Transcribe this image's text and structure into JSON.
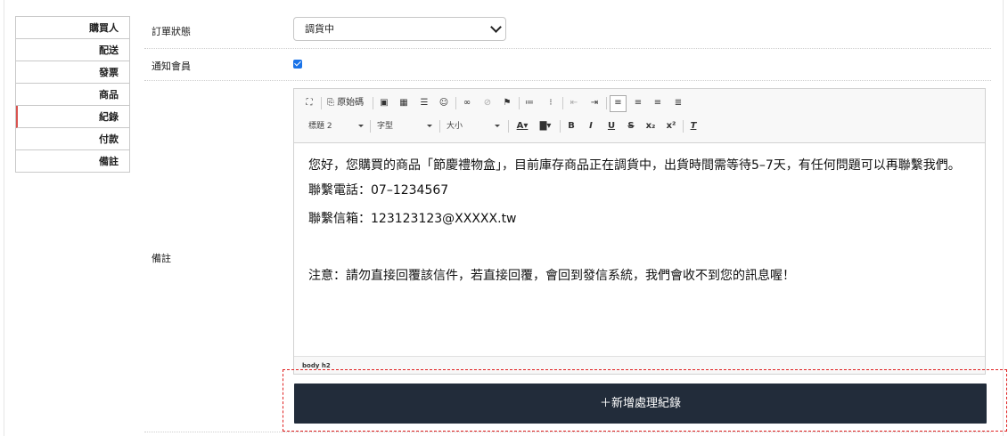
{
  "sidebar": {
    "items": [
      {
        "label": "購買人"
      },
      {
        "label": "配送"
      },
      {
        "label": "發票"
      },
      {
        "label": "商品"
      },
      {
        "label": "紀錄"
      },
      {
        "label": "付款"
      },
      {
        "label": "備註"
      }
    ]
  },
  "form": {
    "order_status_label": "訂單狀態",
    "order_status_value": "調貨中",
    "notify_label": "通知會員",
    "notify_checked": true,
    "note_label": "備註"
  },
  "editor": {
    "toolbar": {
      "source_label": "原始碼",
      "format_value": "標題 2",
      "font_value": "字型",
      "size_value": "大小"
    },
    "content": {
      "line1": "您好，您購買的商品「節慶禮物盒」，目前庫存商品正在調貨中，出貨時間需等待5–7天，有任何問題可以再聯繫我們。",
      "line2": "聯繫電話：07–1234567",
      "line3": "聯繫信箱：123123123@XXXXX.tw",
      "line4": "注意：請勿直接回覆該信件，若直接回覆，會回到發信系統，我們會收不到您的訊息喔！"
    },
    "status_path": "body  h2"
  },
  "actions": {
    "add_record_label": "＋新增處理紀錄"
  },
  "colors": {
    "button_bg": "#222c3a",
    "checkbox": "#1a73e8",
    "highlight": "#e02020"
  }
}
